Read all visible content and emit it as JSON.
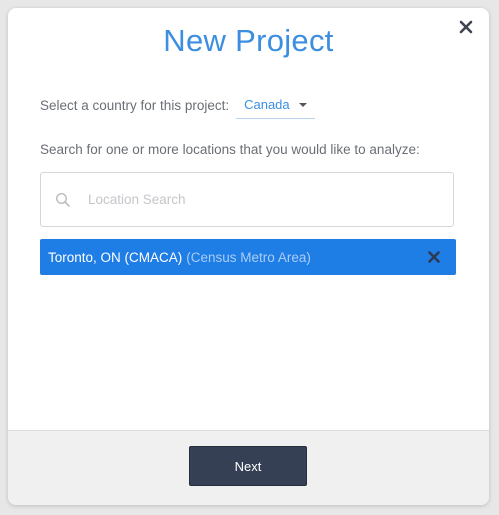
{
  "modal": {
    "title": "New Project"
  },
  "country": {
    "label": "Select a country for this project:",
    "selected": "Canada"
  },
  "search": {
    "prompt": "Search for one or more locations that you would like to analyze:",
    "placeholder": "Location Search",
    "value": ""
  },
  "selected_locations": [
    {
      "name": "Toronto, ON (CMACA)",
      "type": "(Census Metro Area)"
    }
  ],
  "footer": {
    "next_label": "Next"
  },
  "icons": {
    "close": "close-icon",
    "search": "search-icon",
    "caret": "chevron-down-icon",
    "remove": "remove-icon"
  },
  "colors": {
    "accent": "#3b8ee0",
    "chip_background": "#1f7de6",
    "chip_secondary_text": "#a9cdf5",
    "button_background": "#364054",
    "footer_background": "#f0f0f0"
  }
}
